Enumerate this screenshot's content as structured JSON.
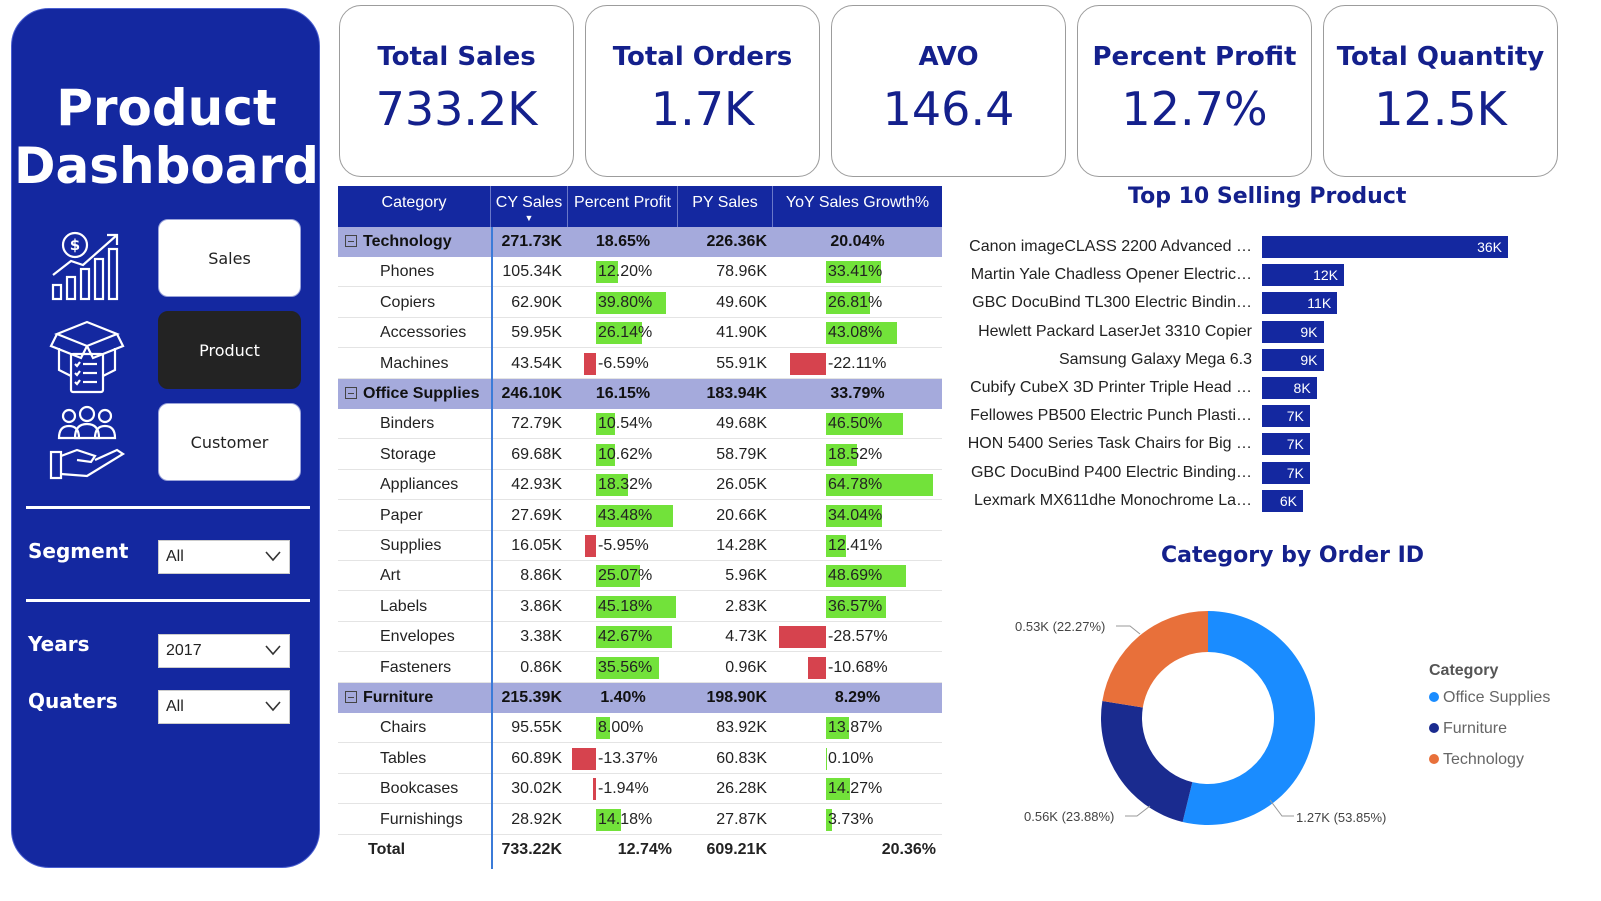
{
  "sidebar": {
    "title_line1": "Product",
    "title_line2": "Dashboard",
    "nav": [
      {
        "label": "Sales",
        "icon": "sales-chart-icon"
      },
      {
        "label": "Product",
        "icon": "product-box-icon"
      },
      {
        "label": "Customer",
        "icon": "customer-hand-icon"
      }
    ],
    "active_nav": "Product",
    "filters": {
      "segment": {
        "label": "Segment",
        "value": "All"
      },
      "years": {
        "label": "Years",
        "value": "2017"
      },
      "quarters": {
        "label": "Quaters",
        "value": "All"
      }
    }
  },
  "kpis": [
    {
      "label": "Total Sales",
      "value": "733.2K"
    },
    {
      "label": "Total Orders",
      "value": "1.7K"
    },
    {
      "label": "AVO",
      "value": "146.4"
    },
    {
      "label": "Percent Profit",
      "value": "12.7%"
    },
    {
      "label": "Total Quantity",
      "value": "12.5K"
    }
  ],
  "table": {
    "headers": [
      "Category",
      "CY Sales",
      "Percent Profit",
      "PY Sales",
      "YoY Sales Growth%"
    ],
    "groups": [
      {
        "name": "Technology",
        "cy": "271.73K",
        "pp": "18.65%",
        "py": "226.36K",
        "yoy": "20.04%",
        "rows": [
          {
            "name": "Phones",
            "cy": "105.34K",
            "pp": "12.20%",
            "pp_v": 12.2,
            "py": "78.96K",
            "yoy": "33.41%",
            "yoy_v": 33.41
          },
          {
            "name": "Copiers",
            "cy": "62.90K",
            "pp": "39.80%",
            "pp_v": 39.8,
            "py": "49.60K",
            "yoy": "26.81%",
            "yoy_v": 26.81
          },
          {
            "name": "Accessories",
            "cy": "59.95K",
            "pp": "26.14%",
            "pp_v": 26.14,
            "py": "41.90K",
            "yoy": "43.08%",
            "yoy_v": 43.08
          },
          {
            "name": "Machines",
            "cy": "43.54K",
            "pp": "-6.59%",
            "pp_v": -6.59,
            "py": "55.91K",
            "yoy": "-22.11%",
            "yoy_v": -22.11
          }
        ]
      },
      {
        "name": "Office Supplies",
        "cy": "246.10K",
        "pp": "16.15%",
        "py": "183.94K",
        "yoy": "33.79%",
        "rows": [
          {
            "name": "Binders",
            "cy": "72.79K",
            "pp": "10.54%",
            "pp_v": 10.54,
            "py": "49.68K",
            "yoy": "46.50%",
            "yoy_v": 46.5
          },
          {
            "name": "Storage",
            "cy": "69.68K",
            "pp": "10.62%",
            "pp_v": 10.62,
            "py": "58.79K",
            "yoy": "18.52%",
            "yoy_v": 18.52
          },
          {
            "name": "Appliances",
            "cy": "42.93K",
            "pp": "18.32%",
            "pp_v": 18.32,
            "py": "26.05K",
            "yoy": "64.78%",
            "yoy_v": 64.78
          },
          {
            "name": "Paper",
            "cy": "27.69K",
            "pp": "43.48%",
            "pp_v": 43.48,
            "py": "20.66K",
            "yoy": "34.04%",
            "yoy_v": 34.04
          },
          {
            "name": "Supplies",
            "cy": "16.05K",
            "pp": "-5.95%",
            "pp_v": -5.95,
            "py": "14.28K",
            "yoy": "12.41%",
            "yoy_v": 12.41
          },
          {
            "name": "Art",
            "cy": "8.86K",
            "pp": "25.07%",
            "pp_v": 25.07,
            "py": "5.96K",
            "yoy": "48.69%",
            "yoy_v": 48.69
          },
          {
            "name": "Labels",
            "cy": "3.86K",
            "pp": "45.18%",
            "pp_v": 45.18,
            "py": "2.83K",
            "yoy": "36.57%",
            "yoy_v": 36.57
          },
          {
            "name": "Envelopes",
            "cy": "3.38K",
            "pp": "42.67%",
            "pp_v": 42.67,
            "py": "4.73K",
            "yoy": "-28.57%",
            "yoy_v": -28.57
          },
          {
            "name": "Fasteners",
            "cy": "0.86K",
            "pp": "35.56%",
            "pp_v": 35.56,
            "py": "0.96K",
            "yoy": "-10.68%",
            "yoy_v": -10.68
          }
        ]
      },
      {
        "name": "Furniture",
        "cy": "215.39K",
        "pp": "1.40%",
        "py": "198.90K",
        "yoy": "8.29%",
        "rows": [
          {
            "name": "Chairs",
            "cy": "95.55K",
            "pp": "8.00%",
            "pp_v": 8.0,
            "py": "83.92K",
            "yoy": "13.87%",
            "yoy_v": 13.87
          },
          {
            "name": "Tables",
            "cy": "60.89K",
            "pp": "-13.37%",
            "pp_v": -13.37,
            "py": "60.83K",
            "yoy": "0.10%",
            "yoy_v": 0.1
          },
          {
            "name": "Bookcases",
            "cy": "30.02K",
            "pp": "-1.94%",
            "pp_v": -1.94,
            "py": "26.28K",
            "yoy": "14.27%",
            "yoy_v": 14.27
          },
          {
            "name": "Furnishings",
            "cy": "28.92K",
            "pp": "14.18%",
            "pp_v": 14.18,
            "py": "27.87K",
            "yoy": "3.73%",
            "yoy_v": 3.73
          }
        ]
      }
    ],
    "total": {
      "name": "Total",
      "cy": "733.22K",
      "pp": "12.74%",
      "py": "609.21K",
      "yoy": "20.36%"
    },
    "colors": {
      "positive": "#72e23a",
      "negative": "#d6434e",
      "header": "#1428a0",
      "group": "#a5aadc"
    }
  },
  "chart_data": [
    {
      "type": "bar",
      "orientation": "horizontal",
      "title": "Top 10 Selling Product",
      "categories": [
        "Canon imageCLASS 2200 Advanced …",
        "Martin Yale Chadless Opener Electric…",
        "GBC DocuBind TL300 Electric Bindin…",
        "Hewlett Packard LaserJet 3310 Copier",
        "Samsung Galaxy Mega 6.3",
        "Cubify CubeX 3D Printer Triple Head …",
        "Fellowes PB500 Electric Punch Plasti…",
        "HON 5400 Series Task Chairs for Big …",
        "GBC DocuBind P400 Electric Binding…",
        "Lexmark MX611dhe Monochrome La…"
      ],
      "values": [
        36000,
        12000,
        11000,
        9000,
        9000,
        8000,
        7000,
        7000,
        7000,
        6000
      ],
      "value_labels": [
        "36K",
        "12K",
        "11K",
        "9K",
        "9K",
        "8K",
        "7K",
        "7K",
        "7K",
        "6K"
      ],
      "color": "#1428a0"
    },
    {
      "type": "pie",
      "variant": "donut",
      "title": "Category by Order ID",
      "legend_title": "Category",
      "legend_position": "right",
      "slices": [
        {
          "name": "Office Supplies",
          "value": 1270,
          "label": "1.27K (53.85%)",
          "color": "#1a8cff"
        },
        {
          "name": "Furniture",
          "value": 560,
          "label": "0.56K (23.88%)",
          "color": "#1a2b8f"
        },
        {
          "name": "Technology",
          "value": 530,
          "label": "0.53K (22.27%)",
          "color": "#e8703a"
        }
      ]
    }
  ]
}
